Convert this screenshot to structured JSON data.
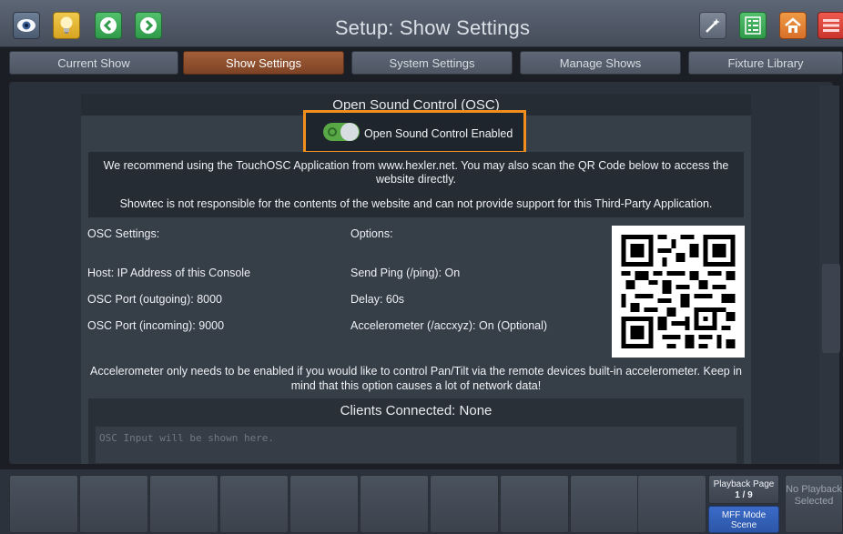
{
  "header": {
    "title": "Setup: Show Settings",
    "left_buttons": [
      "eye-icon",
      "lightbulb-icon",
      "back-arrow-icon",
      "forward-arrow-icon"
    ],
    "right_buttons": [
      "magic-wand-icon",
      "list-icon",
      "home-icon",
      "menu-icon"
    ]
  },
  "tabs": [
    {
      "label": "Current Show",
      "active": false
    },
    {
      "label": "Show Settings",
      "active": true
    },
    {
      "label": "System Settings",
      "active": false
    },
    {
      "label": "Manage Shows",
      "active": false
    },
    {
      "label": "Fixture Library",
      "active": false
    }
  ],
  "osc": {
    "section_title": "Open Sound Control (OSC)",
    "toggle_label": "Open Sound Control Enabled",
    "toggle_on": true,
    "notice_line1": "We recommend using the TouchOSC Application from www.hexler.net. You may also scan the QR Code below to access the website directly.",
    "notice_line2": "Showtec is not responsible for the contents of the website and can not provide support for this Third-Party Application.",
    "settings_heading": "OSC Settings:",
    "host": "Host: IP Address of this Console",
    "port_out": "OSC Port (outgoing): 8000",
    "port_in": "OSC Port (incoming): 9000",
    "options_heading": "Options:",
    "send_ping": "Send Ping (/ping): On",
    "delay": "Delay: 60s",
    "accelerometer": "Accelerometer (/accxyz): On (Optional)",
    "accel_note": "Accelerometer only needs to be enabled if you would like to control Pan/Tilt via the remote devices built-in accelerometer. Keep in mind that this option causes a lot of network data!",
    "clients_title": "Clients Connected: None",
    "input_placeholder": "OSC Input will be shown here."
  },
  "bottom": {
    "playback_page_label": "Playback Page",
    "playback_page_value": "1 / 9",
    "mff_label": "MFF Mode",
    "mff_value": "Scene",
    "no_playback": "No Playback Selected"
  },
  "colors": {
    "accent_orange": "#f28e1d",
    "active_tab": "#8f4f2e",
    "toggle_green": "#59a846",
    "mff_blue": "#2f5fbc"
  }
}
